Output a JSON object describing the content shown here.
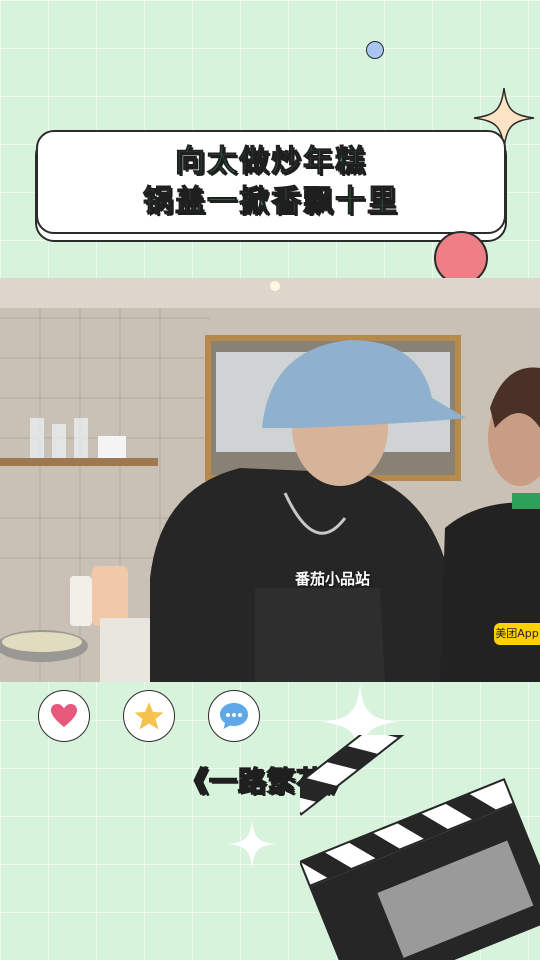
{
  "title": {
    "line1": "向太做炒年糕",
    "line2": "锅盖一掀香飘十里"
  },
  "video": {
    "watermark": "番茄小品站",
    "badge": "美团App"
  },
  "actions": [
    {
      "icon": "heart-icon",
      "color": "#e8587a"
    },
    {
      "icon": "star-icon",
      "color": "#f4c24d"
    },
    {
      "icon": "comment-icon",
      "color": "#5fa8e8"
    }
  ],
  "show_title": "《一路繁花》",
  "colors": {
    "background": "#d8f3dc",
    "title_text": "#3aa35a",
    "accent_red": "#ef7f86",
    "accent_blue": "#a9c6f0"
  }
}
